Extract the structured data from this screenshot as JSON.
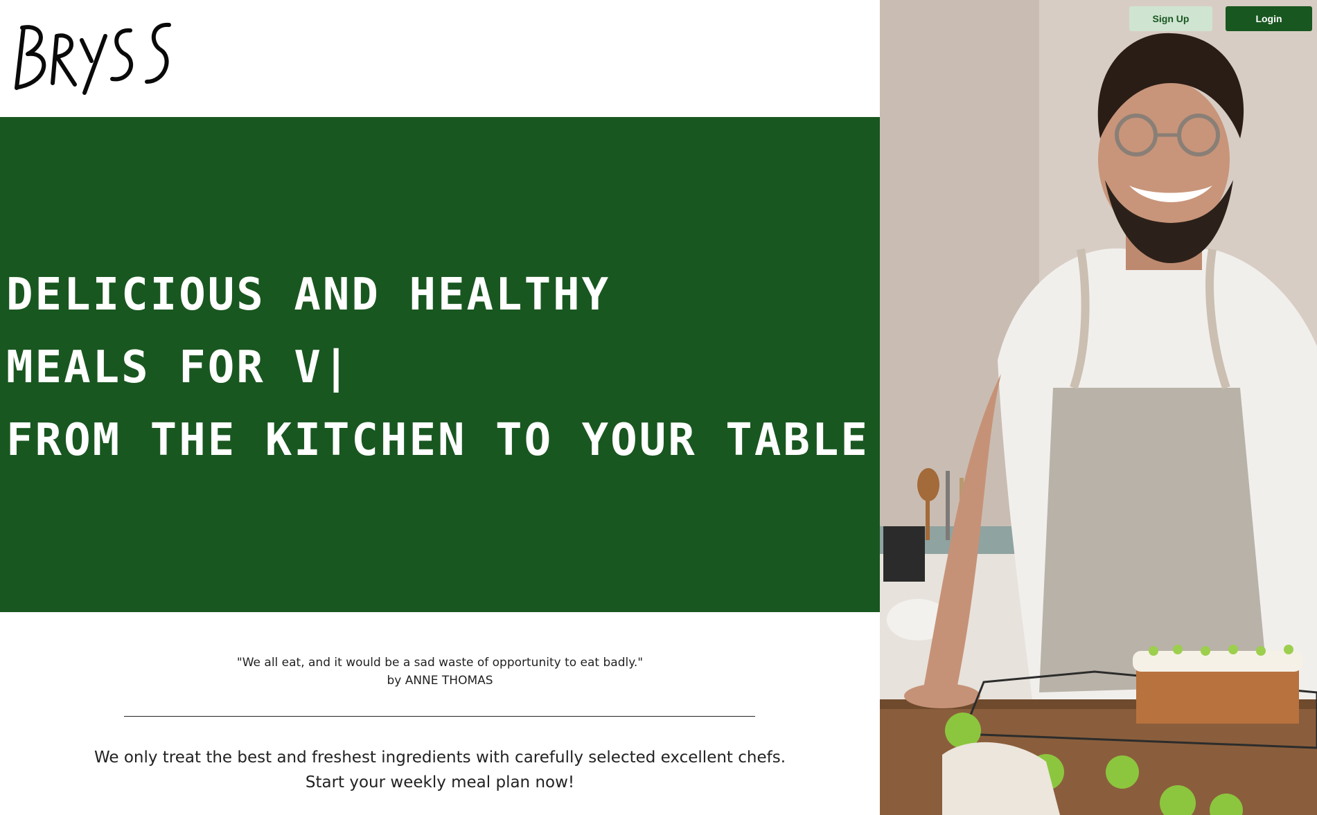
{
  "brand": {
    "logo_text": "BRYSS"
  },
  "auth": {
    "signup_label": "Sign Up",
    "login_label": "Login"
  },
  "hero": {
    "line1": "DELICIOUS AND HEALTHY",
    "line2": "MEALS FOR V|",
    "line3": "FROM THE KITCHEN TO YOUR TABLE"
  },
  "quote": {
    "text": "\"We all eat, and it would be a sad waste of opportunity to eat badly.\"",
    "author": "by ANNE THOMAS"
  },
  "intro": {
    "line1": "We only treat the best and freshest ingredients with carefully selected excellent chefs.",
    "line2": "Start your weekly meal plan now!"
  },
  "colors": {
    "brand_green": "#195720",
    "signup_bg": "#cfe4d1",
    "text": "#222222"
  },
  "icons": {
    "logo": "bryss-handwritten-logo",
    "photo": "smiling-chef-with-cake-photo"
  }
}
